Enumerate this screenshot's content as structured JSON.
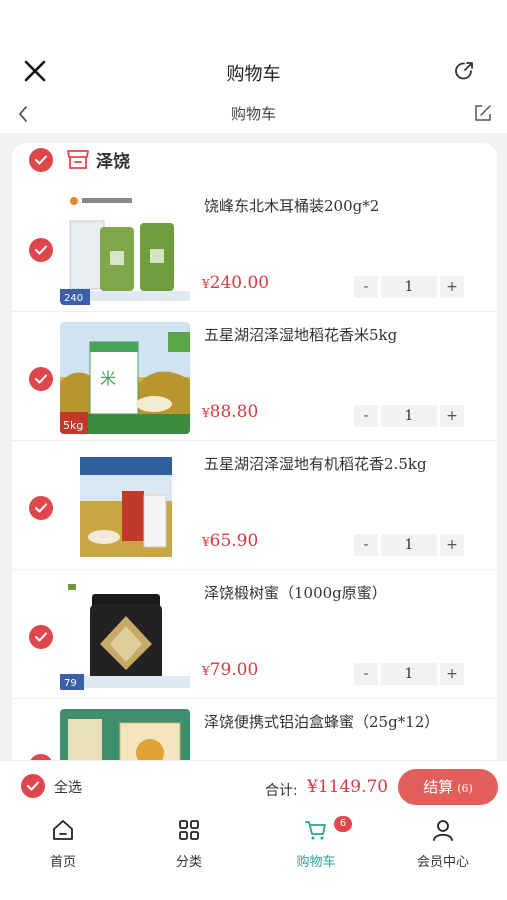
{
  "header": {
    "title": "购物车"
  },
  "subheader": {
    "title": "购物车"
  },
  "store": {
    "name": "泽饶"
  },
  "items": [
    {
      "name": "饶峰东北木耳桶装200g*2",
      "price": "240.00",
      "qty": "1",
      "img_label": "240"
    },
    {
      "name": "五星湖沼泽湿地稻花香米5kg",
      "price": "88.80",
      "qty": "1",
      "img_label": "5kg"
    },
    {
      "name": "五星湖沼泽湿地有机稻花香2.5kg",
      "price": "65.90",
      "qty": "1",
      "img_label": ""
    },
    {
      "name": "泽饶椴树蜜（1000g原蜜）",
      "price": "79.00",
      "qty": "1",
      "img_label": "79"
    },
    {
      "name": "泽饶便携式铝泊盒蜂蜜（25g*12）",
      "price": "",
      "qty": "",
      "img_label": ""
    }
  ],
  "currency": "¥",
  "stepper": {
    "minus": "-",
    "plus": "+"
  },
  "checkout": {
    "select_all": "全选",
    "total_label": "合计:",
    "total": "¥1149.70",
    "button": "结算",
    "count": "(6)"
  },
  "tabs": [
    {
      "label": "首页",
      "icon": "home-icon"
    },
    {
      "label": "分类",
      "icon": "grid-icon"
    },
    {
      "label": "购物车",
      "icon": "cart-icon",
      "badge": "6",
      "active": true
    },
    {
      "label": "会员中心",
      "icon": "user-icon"
    }
  ],
  "colors": {
    "accent": "#e0474c",
    "price": "#d9383e",
    "active_tab": "#2aa59a",
    "checkout_button": "#e15e5b"
  }
}
